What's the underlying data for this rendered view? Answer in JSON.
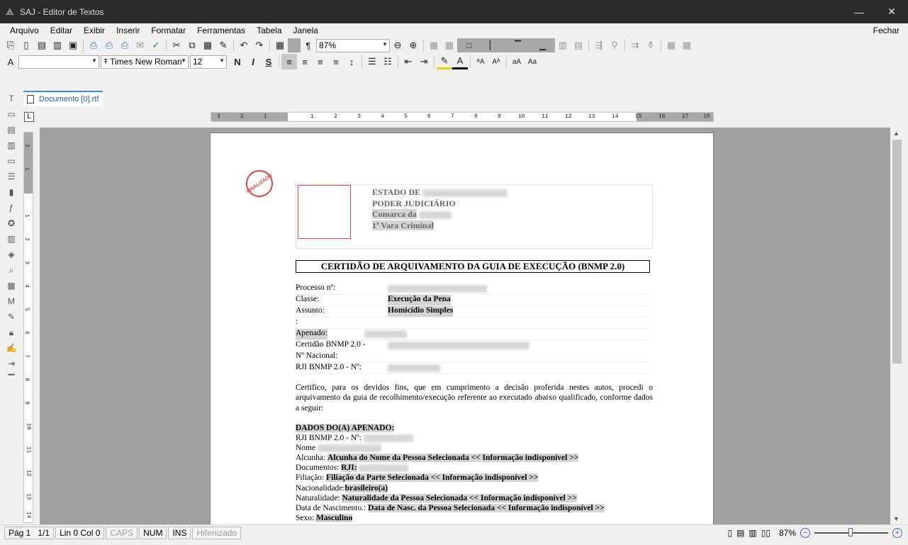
{
  "window": {
    "title": "SAJ - Editor de Textos",
    "minimize": "—",
    "close": "✕"
  },
  "menu": {
    "items": [
      "Arquivo",
      "Editar",
      "Exibir",
      "Inserir",
      "Formatar",
      "Ferramentas",
      "Tabela",
      "Janela"
    ],
    "close_label": "Fechar"
  },
  "toolbar": {
    "zoom_value": "87%",
    "font_name": "Times New Roman",
    "font_size": "12",
    "style_value": ""
  },
  "tab": {
    "label": "Documento [0].rtf"
  },
  "ruler": {
    "h_ticks": [
      "3",
      "2",
      "1",
      "1",
      "2",
      "3",
      "4",
      "5",
      "6",
      "7",
      "8",
      "9",
      "10",
      "11",
      "12",
      "13",
      "14",
      "15",
      "16",
      "17",
      "18"
    ],
    "v_ticks": [
      "2",
      "1",
      "1",
      "2",
      "3",
      "4",
      "5",
      "6",
      "7",
      "8",
      "9",
      "10",
      "11",
      "12",
      "13",
      "14"
    ]
  },
  "document": {
    "stamp_text": "FINALIZADO",
    "header": {
      "line1": "ESTADO DE",
      "line2": "PODER JUDICIÁRIO",
      "line3": "Comarca da",
      "line4": "1ª Vara Criminal"
    },
    "title": "CERTIDÃO DE ARQUIVAMENTO DA GUIA DE EXECUÇÃO (BNMP 2.0)",
    "fields": [
      {
        "key": "Processo nº:",
        "value": ""
      },
      {
        "key": "Classe:",
        "value": "Execução da Pena"
      },
      {
        "key": "Assunto:",
        "value": "Homicídio Simples"
      },
      {
        "key": ":",
        "value": ""
      },
      {
        "key": "Apenado:",
        "value": ""
      },
      {
        "key": "Certidão BNMP 2.0 -",
        "value": ""
      },
      {
        "key": "Nº Nacional:",
        "value": ""
      },
      {
        "key": "RJI BNMP 2.0 - Nº:",
        "value": ""
      }
    ],
    "paragraph": "Certifico, para os devidos fins, que em cumprimento a decisão proferida nestes autos, procedi o arquivamento da guia de recolhimento/execução referente ao executado abaixo qualificado, conforme dados a seguir:",
    "section_title": "DADOS DO(A) APENADO:",
    "details": [
      {
        "label": "RJI BNMP 2.0 - Nº:",
        "value": ""
      },
      {
        "label": "Nome",
        "value": ""
      },
      {
        "label": "Alcunha:",
        "value": "Alcunha do Nome da Pessoa Selecionada << Informação indisponível >>"
      },
      {
        "label": "Documentos:",
        "value": "RJI:"
      },
      {
        "label": "Filiação:",
        "value": "Filiação da Parte Selecionada << Informação indisponível >>"
      },
      {
        "label": "Nacionalidade:",
        "value": "brasileiro(a)"
      },
      {
        "label": "Naturalidade:",
        "value": "Naturalidade da Pessoa Selecionada << Informação indisponível >>"
      },
      {
        "label": "Data de Nascimento.:",
        "value": "Data de Nasc. da Pessoa Selecionada << Informação indisponível >>"
      },
      {
        "label": "Sexo:",
        "value": "Masculino"
      }
    ]
  },
  "status": {
    "page": "Pág 1",
    "pages": "1/1",
    "position": "Lin 0  Col 0",
    "caps": "CAPS",
    "num": "NUM",
    "ins": "INS",
    "hyphen": "Hifenizado",
    "zoom": "87%"
  }
}
